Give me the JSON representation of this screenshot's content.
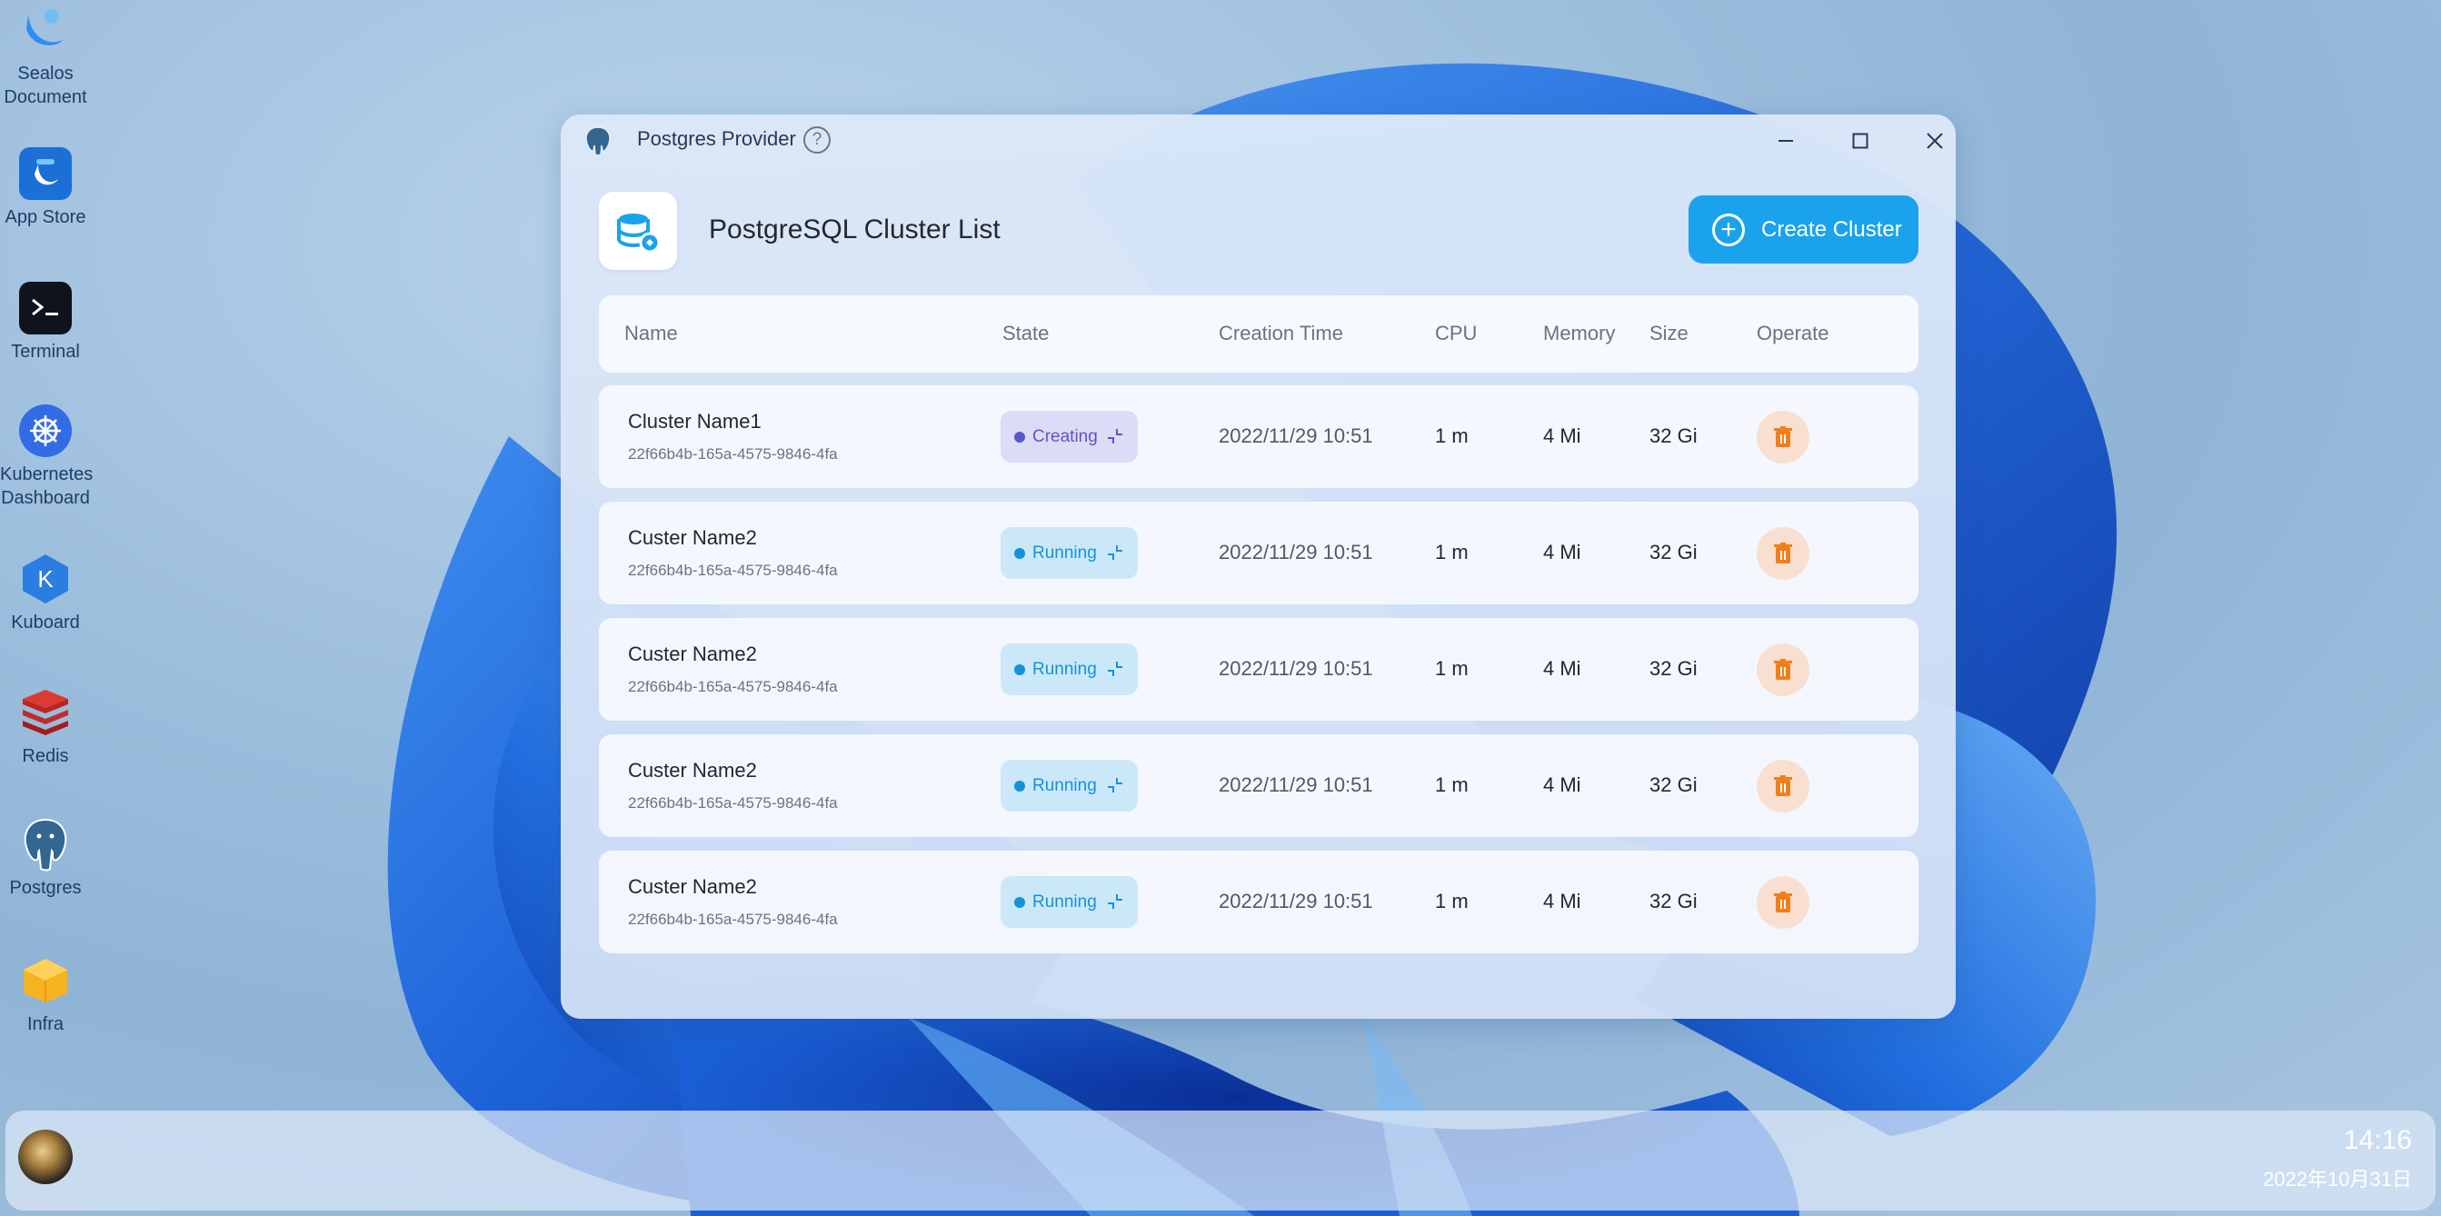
{
  "desktop": {
    "icons": [
      {
        "label_line1": "Sealos",
        "label_line2": "Document",
        "icon": "sealos-icon"
      },
      {
        "label_line1": "App Store",
        "label_line2": "",
        "icon": "app-store-icon"
      },
      {
        "label_line1": "Terminal",
        "label_line2": "",
        "icon": "terminal-icon"
      },
      {
        "label_line1": "Kubernetes",
        "label_line2": "Dashboard",
        "icon": "kubernetes-icon"
      },
      {
        "label_line1": "Kuboard",
        "label_line2": "",
        "icon": "kuboard-icon"
      },
      {
        "label_line1": "Redis",
        "label_line2": "",
        "icon": "redis-icon"
      },
      {
        "label_line1": "Postgres",
        "label_line2": "",
        "icon": "postgres-icon"
      },
      {
        "label_line1": "Infra",
        "label_line2": "",
        "icon": "infra-icon"
      }
    ]
  },
  "window": {
    "title": "Postgres Provider",
    "help_glyph": "?",
    "page_title": "PostgreSQL Cluster List",
    "create_button": "Create Cluster",
    "columns": {
      "name": "Name",
      "state": "State",
      "creation_time": "Creation Time",
      "cpu": "CPU",
      "memory": "Memory",
      "size": "Size",
      "operate": "Operate"
    },
    "rows": [
      {
        "name": "Cluster Name1",
        "id": "22f66b4b-165a-4575-9846-4fa",
        "state": "Creating",
        "time": "2022/11/29 10:51",
        "cpu": "1 m",
        "memory": "4 Mi",
        "size": "32 Gi"
      },
      {
        "name": "Custer Name2",
        "id": "22f66b4b-165a-4575-9846-4fa",
        "state": "Running",
        "time": "2022/11/29 10:51",
        "cpu": "1 m",
        "memory": "4 Mi",
        "size": "32 Gi"
      },
      {
        "name": "Custer Name2",
        "id": "22f66b4b-165a-4575-9846-4fa",
        "state": "Running",
        "time": "2022/11/29 10:51",
        "cpu": "1 m",
        "memory": "4 Mi",
        "size": "32 Gi"
      },
      {
        "name": "Custer Name2",
        "id": "22f66b4b-165a-4575-9846-4fa",
        "state": "Running",
        "time": "2022/11/29 10:51",
        "cpu": "1 m",
        "memory": "4 Mi",
        "size": "32 Gi"
      },
      {
        "name": "Custer Name2",
        "id": "22f66b4b-165a-4575-9846-4fa",
        "state": "Running",
        "time": "2022/11/29 10:51",
        "cpu": "1 m",
        "memory": "4 Mi",
        "size": "32 Gi"
      }
    ]
  },
  "taskbar": {
    "time": "14:16",
    "date": "2022年10月31日"
  },
  "colors": {
    "accent": "#1aa3ec",
    "creating": "#5a58c9",
    "running": "#1492d8",
    "delete": "#f07f1b"
  }
}
